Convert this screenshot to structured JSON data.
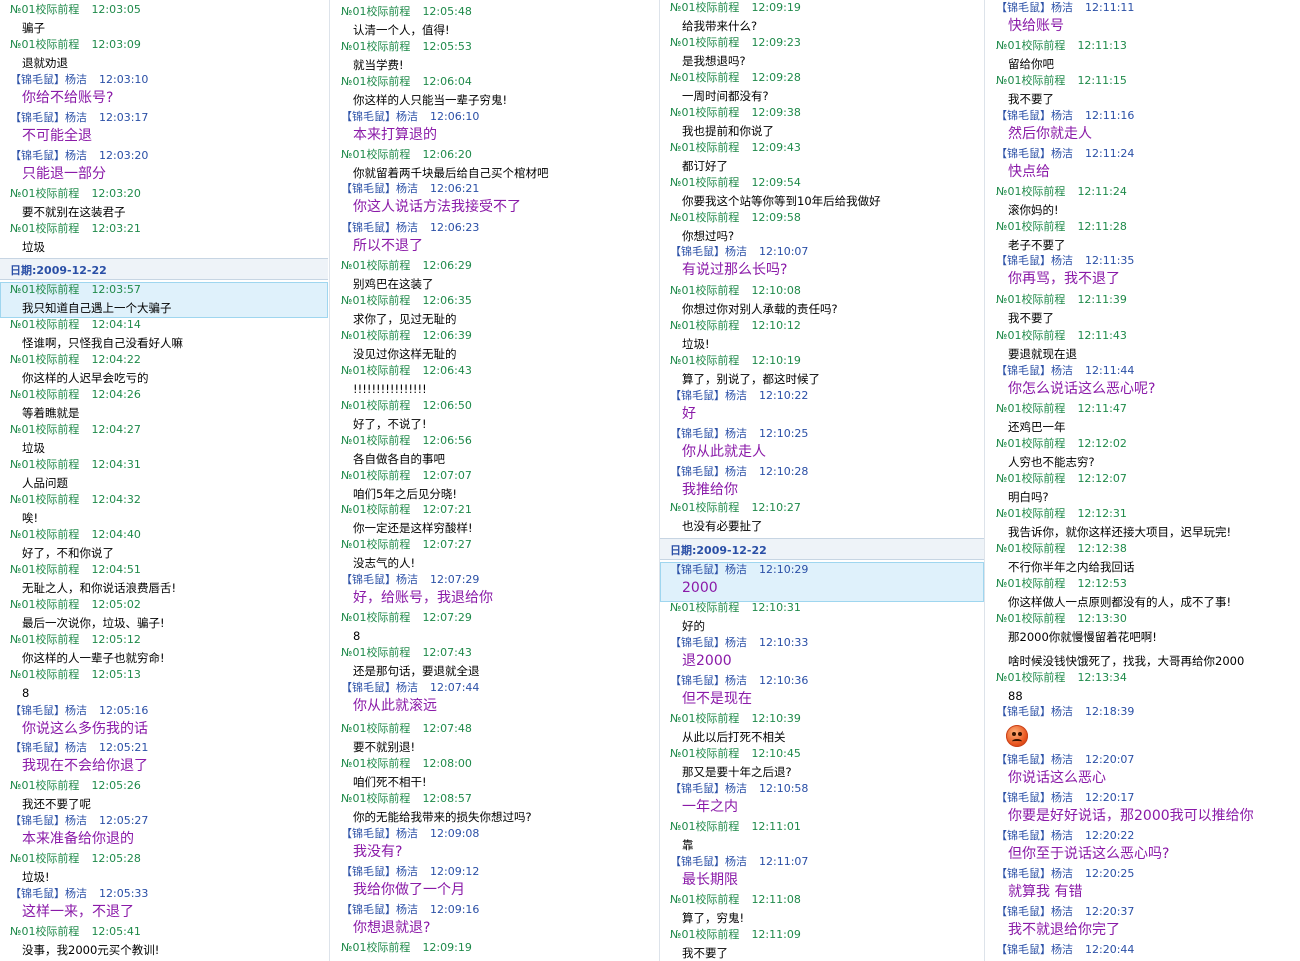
{
  "users": {
    "a": "№01校际前程",
    "b": "【锦毛鼠】杨洁"
  },
  "date_label": "日期:2009-12-22",
  "columns": [
    {
      "entries": [
        {
          "s": "a",
          "t": "12:03:05",
          "m": "骗子"
        },
        {
          "s": "a",
          "t": "12:03:09",
          "m": "退就劝退"
        },
        {
          "s": "b",
          "t": "12:03:10",
          "m": "你给不给账号?"
        },
        {
          "s": "b",
          "t": "12:03:17",
          "m": "不可能全退"
        },
        {
          "s": "b",
          "t": "12:03:20",
          "m": "只能退一部分"
        },
        {
          "s": "a",
          "t": "12:03:20",
          "m": "要不就别在这装君子"
        },
        {
          "s": "a",
          "t": "12:03:21",
          "m": "垃圾"
        },
        {
          "date": true
        },
        {
          "s": "a",
          "t": "12:03:57",
          "m": "我只知道自己遇上一个大骗子",
          "hl": true
        },
        {
          "s": "a",
          "t": "12:04:14",
          "m": "怪谁啊，只怪我自己没看好人嘛"
        },
        {
          "s": "a",
          "t": "12:04:22",
          "m": "你这样的人迟早会吃亏的"
        },
        {
          "s": "a",
          "t": "12:04:26",
          "m": "等着瞧就是"
        },
        {
          "s": "a",
          "t": "12:04:27",
          "m": "垃圾"
        },
        {
          "s": "a",
          "t": "12:04:31",
          "m": "人品问题"
        },
        {
          "s": "a",
          "t": "12:04:32",
          "m": "唉!"
        },
        {
          "s": "a",
          "t": "12:04:40",
          "m": "好了，不和你说了"
        },
        {
          "s": "a",
          "t": "12:04:51",
          "m": "无耻之人，和你说话浪费唇舌!"
        },
        {
          "s": "a",
          "t": "12:05:02",
          "m": "最后一次说你，垃圾、骗子!"
        },
        {
          "s": "a",
          "t": "12:05:12",
          "m": "你这样的人一辈子也就穷命!"
        },
        {
          "s": "a",
          "t": "12:05:13",
          "m": "8"
        },
        {
          "s": "b",
          "t": "12:05:16",
          "m": "你说这么多伤我的话"
        },
        {
          "s": "b",
          "t": "12:05:21",
          "m": "我现在不会给你退了"
        },
        {
          "s": "a",
          "t": "12:05:26",
          "m": "我还不要了呢"
        },
        {
          "s": "b",
          "t": "12:05:27",
          "m": "本来准备给你退的"
        },
        {
          "s": "a",
          "t": "12:05:28",
          "m": "垃圾!"
        },
        {
          "s": "b",
          "t": "12:05:33",
          "m": "这样一来，不退了"
        },
        {
          "s": "a",
          "t": "12:05:41",
          "m": "没事，我2000元买个教训!"
        }
      ]
    },
    {
      "entries": [
        {
          "s": "a",
          "t": "12:05:48",
          "m": "认清一个人，值得!"
        },
        {
          "s": "a",
          "t": "12:05:53",
          "m": "就当学费!"
        },
        {
          "s": "a",
          "t": "12:06:04",
          "m": "你这样的人只能当一辈子穷鬼!"
        },
        {
          "s": "b",
          "t": "12:06:10",
          "m": "本来打算退的"
        },
        {
          "s": "a",
          "t": "12:06:20",
          "m": "你就留着两千块最后给自己买个棺材吧"
        },
        {
          "s": "b",
          "t": "12:06:21",
          "m": "你这人说话方法我接受不了"
        },
        {
          "s": "b",
          "t": "12:06:23",
          "m": "所以不退了"
        },
        {
          "s": "a",
          "t": "12:06:29",
          "m": "别鸡巴在这装了"
        },
        {
          "s": "a",
          "t": "12:06:35",
          "m": "求你了，见过无耻的"
        },
        {
          "s": "a",
          "t": "12:06:39",
          "m": "没见过你这样无耻的"
        },
        {
          "s": "a",
          "t": "12:06:43",
          "m": "!!!!!!!!!!!!!!!!"
        },
        {
          "s": "a",
          "t": "12:06:50",
          "m": "好了，不说了!"
        },
        {
          "s": "a",
          "t": "12:06:56",
          "m": "各自做各自的事吧"
        },
        {
          "s": "a",
          "t": "12:07:07",
          "m": "咱们5年之后见分晓!"
        },
        {
          "s": "a",
          "t": "12:07:21",
          "m": "你一定还是这样穷酸样!"
        },
        {
          "s": "a",
          "t": "12:07:27",
          "m": "没志气的人!"
        },
        {
          "s": "b",
          "t": "12:07:29",
          "m": "好，给账号，我退给你"
        },
        {
          "s": "a",
          "t": "12:07:29",
          "m": "8"
        },
        {
          "s": "a",
          "t": "12:07:43",
          "m": "还是那句话，要退就全退"
        },
        {
          "s": "b",
          "t": "12:07:44",
          "m": "你从此就滚远"
        },
        {
          "s": "a",
          "t": "12:07:48",
          "m": "要不就别退!"
        },
        {
          "s": "a",
          "t": "12:08:00",
          "m": "咱们死不相干!"
        },
        {
          "s": "a",
          "t": "12:08:57",
          "m": "你的无能给我带来的损失你想过吗?"
        },
        {
          "s": "b",
          "t": "12:09:08",
          "m": "我没有?"
        },
        {
          "s": "b",
          "t": "12:09:12",
          "m": "我给你做了一个月"
        },
        {
          "s": "b",
          "t": "12:09:16",
          "m": "你想退就退?"
        },
        {
          "s": "a",
          "t": "12:09:19",
          "m": ""
        }
      ]
    },
    {
      "entries": [
        {
          "s": "a",
          "t": "12:09:19",
          "m": "给我带来什么?"
        },
        {
          "s": "a",
          "t": "12:09:23",
          "m": "是我想退吗?"
        },
        {
          "s": "a",
          "t": "12:09:28",
          "m": "一周时间都没有?"
        },
        {
          "s": "a",
          "t": "12:09:38",
          "m": "我也提前和你说了"
        },
        {
          "s": "a",
          "t": "12:09:43",
          "m": "都订好了"
        },
        {
          "s": "a",
          "t": "12:09:54",
          "m": "你要我这个站等你等到10年后给我做好"
        },
        {
          "s": "a",
          "t": "12:09:58",
          "m": "你想过吗?"
        },
        {
          "s": "b",
          "t": "12:10:07",
          "m": "有说过那么长吗?"
        },
        {
          "s": "a",
          "t": "12:10:08",
          "m": "你想过你对别人承载的责任吗?"
        },
        {
          "s": "a",
          "t": "12:10:12",
          "m": "垃圾!"
        },
        {
          "s": "a",
          "t": "12:10:19",
          "m": "算了，别说了，都这时候了"
        },
        {
          "s": "b",
          "t": "12:10:22",
          "m": "好"
        },
        {
          "s": "b",
          "t": "12:10:25",
          "m": "你从此就走人"
        },
        {
          "s": "b",
          "t": "12:10:28",
          "m": "我推给你"
        },
        {
          "s": "a",
          "t": "12:10:27",
          "m": "也没有必要扯了"
        },
        {
          "date": true
        },
        {
          "s": "b",
          "t": "12:10:29",
          "m": "2000",
          "hl": true
        },
        {
          "s": "a",
          "t": "12:10:31",
          "m": "好的"
        },
        {
          "s": "b",
          "t": "12:10:33",
          "m": "退2000"
        },
        {
          "s": "b",
          "t": "12:10:36",
          "m": "但不是现在"
        },
        {
          "s": "a",
          "t": "12:10:39",
          "m": "从此以后打死不相关"
        },
        {
          "s": "a",
          "t": "12:10:45",
          "m": "那又是要十年之后退?"
        },
        {
          "s": "b",
          "t": "12:10:58",
          "m": "一年之内"
        },
        {
          "s": "a",
          "t": "12:11:01",
          "m": "靠"
        },
        {
          "s": "b",
          "t": "12:11:07",
          "m": "最长期限"
        },
        {
          "s": "a",
          "t": "12:11:08",
          "m": "算了，穷鬼!"
        },
        {
          "s": "a",
          "t": "12:11:09",
          "m": "我不要了"
        }
      ]
    },
    {
      "entries": [
        {
          "s": "b",
          "t": "12:11:11",
          "m": "快给账号"
        },
        {
          "s": "a",
          "t": "12:11:13",
          "m": "留给你吧"
        },
        {
          "s": "a",
          "t": "12:11:15",
          "m": "我不要了"
        },
        {
          "s": "b",
          "t": "12:11:16",
          "m": "然后你就走人"
        },
        {
          "s": "b",
          "t": "12:11:24",
          "m": "快点给"
        },
        {
          "s": "a",
          "t": "12:11:24",
          "m": "滚你妈的!"
        },
        {
          "s": "a",
          "t": "12:11:28",
          "m": "老子不要了"
        },
        {
          "s": "b",
          "t": "12:11:35",
          "m": "你再骂，我不退了"
        },
        {
          "s": "a",
          "t": "12:11:39",
          "m": "我不要了"
        },
        {
          "s": "a",
          "t": "12:11:43",
          "m": "要退就现在退"
        },
        {
          "s": "b",
          "t": "12:11:44",
          "m": "你怎么说话这么恶心呢?"
        },
        {
          "s": "a",
          "t": "12:11:47",
          "m": "还鸡巴一年"
        },
        {
          "s": "a",
          "t": "12:12:02",
          "m": "人穷也不能志穷?"
        },
        {
          "s": "a",
          "t": "12:12:07",
          "m": "明白吗?"
        },
        {
          "s": "a",
          "t": "12:12:31",
          "m": "我告诉你，就你这样还接大项目，迟早玩完!"
        },
        {
          "s": "a",
          "t": "12:12:38",
          "m": "不行你半年之内给我回话"
        },
        {
          "s": "a",
          "t": "12:12:53",
          "m": "你这样做人一点原则都没有的人，成不了事!"
        },
        {
          "s": "a",
          "t": "12:13:30",
          "m": "那2000你就慢慢留着花吧啊!"
        },
        {
          "s": "x",
          "t": "",
          "m": "啥时候没钱快饿死了，找我，大哥再给你2000"
        },
        {
          "s": "a",
          "t": "12:13:34",
          "m": "88"
        },
        {
          "s": "b",
          "t": "12:18:39",
          "m": "",
          "emoji": "angry-face-icon"
        },
        {
          "s": "b",
          "t": "12:20:07",
          "m": "你说话这么恶心"
        },
        {
          "s": "b",
          "t": "12:20:17",
          "m": "你要是好好说话，那2000我可以推给你"
        },
        {
          "s": "b",
          "t": "12:20:22",
          "m": "但你至于说话这么恶心吗?"
        },
        {
          "s": "b",
          "t": "12:20:25",
          "m": "就算我 有错"
        },
        {
          "s": "b",
          "t": "12:20:37",
          "m": "我不就退给你完了"
        },
        {
          "s": "b",
          "t": "12:20:44",
          "m": ""
        }
      ]
    }
  ]
}
